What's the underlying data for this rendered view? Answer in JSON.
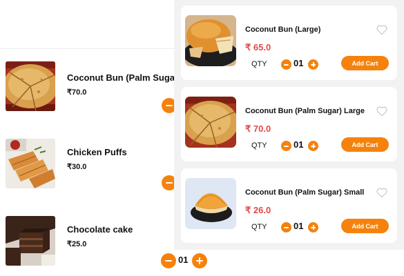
{
  "background_list": {
    "items": [
      {
        "name": "Coconut Bun (Palm Sugar) L",
        "price": "₹70.0",
        "image": "coconut-bun-image"
      },
      {
        "name": "Chicken Puffs",
        "price": "₹30.0",
        "image": "chicken-puffs-image"
      },
      {
        "name": "Chocolate cake",
        "price": "₹25.0",
        "image": "chocolate-cake-image"
      }
    ],
    "bottom_qty": "01",
    "icons": {
      "minus": "minus-icon",
      "plus": "plus-icon"
    }
  },
  "cart": {
    "qty_label": "QTY",
    "add_label": "Add Cart",
    "items": [
      {
        "name": "Coconut Bun (Large)",
        "price": "₹ 65.0",
        "qty": "01",
        "image": "coconut-bun-large-image"
      },
      {
        "name": "Coconut Bun (Palm Sugar) Large",
        "price": "₹ 70.0",
        "qty": "01",
        "image": "coconut-bun-palm-sugar-image"
      },
      {
        "name": "Coconut Bun (Palm Sugar) Small",
        "price": "₹ 26.0",
        "qty": "01",
        "image": "coconut-bun-small-image"
      }
    ]
  },
  "colors": {
    "accent": "#f5820d",
    "price": "#e04848",
    "panel_bg": "#f2f2f2",
    "heart": "#c8c8c8"
  }
}
